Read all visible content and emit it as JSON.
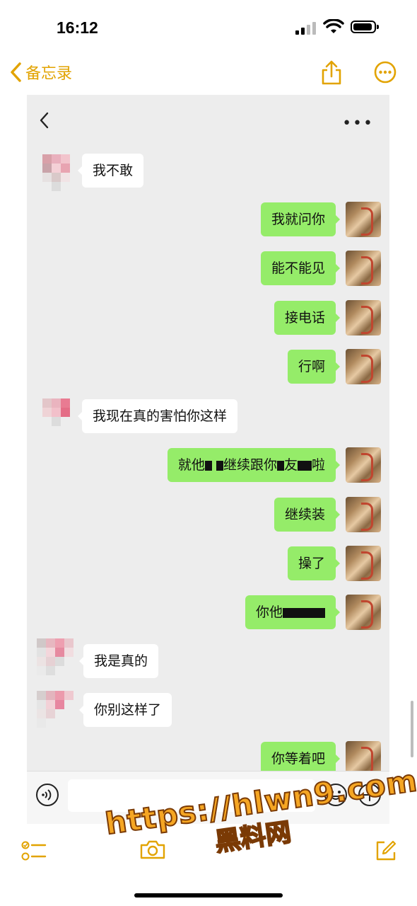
{
  "status_bar": {
    "time": "16:12"
  },
  "notes_nav": {
    "back_label": "备忘录"
  },
  "chat": {
    "messages": [
      {
        "side": "in",
        "text": "我不敢"
      },
      {
        "side": "out",
        "text": "我就问你"
      },
      {
        "side": "out",
        "text": "能不能见"
      },
      {
        "side": "out",
        "text": "接电话"
      },
      {
        "side": "out",
        "text": "行啊"
      },
      {
        "side": "in",
        "text": "我现在真的害怕你这样"
      },
      {
        "side": "out",
        "text_parts": [
          "就他",
          "继续跟你",
          "友",
          "啦"
        ]
      },
      {
        "side": "out",
        "text": "继续装"
      },
      {
        "side": "out",
        "text": "操了"
      },
      {
        "side": "out",
        "text_parts": [
          "你他"
        ]
      },
      {
        "side": "in",
        "text": "我是真的"
      },
      {
        "side": "in",
        "text": "你别这样了"
      },
      {
        "side": "out",
        "text": "你等着吧"
      }
    ]
  },
  "watermark": {
    "url": "https://hlwn9.com",
    "name": "黑料网"
  },
  "colors": {
    "accent": "#e2a300",
    "out_bubble": "#95ec69",
    "chat_bg": "#ededed"
  },
  "icons": [
    "chevron-left-icon",
    "share-icon",
    "more-circle-icon",
    "ellipsis-icon",
    "voice-icon",
    "emoji-icon",
    "plus-icon",
    "checklist-icon",
    "camera-icon",
    "compose-icon"
  ]
}
